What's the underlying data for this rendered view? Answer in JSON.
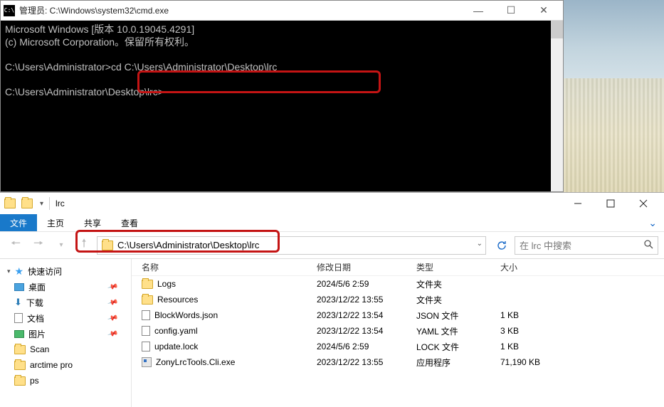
{
  "cmd": {
    "title": "管理员: C:\\Windows\\system32\\cmd.exe",
    "line1": "Microsoft Windows [版本 10.0.19045.4291]",
    "line2": "(c) Microsoft Corporation。保留所有权利。",
    "line3_prompt": "C:\\Users\\Administrator>",
    "line3_cmd": "cd C:\\Users\\Administrator\\Desktop\\lrc",
    "line4_prompt": "C:\\Users\\Administrator\\Desktop\\lrc>",
    "icon_text": "C:\\",
    "ctrl": {
      "min": "—",
      "max": "☐",
      "close": "✕"
    }
  },
  "explorer": {
    "title_folder": "lrc",
    "menu": {
      "file": "文件",
      "home": "主页",
      "share": "共享",
      "view": "查看"
    },
    "address": "C:\\Users\\Administrator\\Desktop\\lrc",
    "search_placeholder": "在 lrc 中搜索",
    "cols": {
      "name": "名称",
      "date": "修改日期",
      "type": "类型",
      "size": "大小"
    },
    "sidebar": {
      "quick": "快速访问",
      "items": [
        {
          "label": "桌面",
          "icon": "desk"
        },
        {
          "label": "下载",
          "icon": "dl"
        },
        {
          "label": "文档",
          "icon": "doc"
        },
        {
          "label": "图片",
          "icon": "pic"
        },
        {
          "label": "Scan",
          "icon": "folder"
        },
        {
          "label": "arctime pro",
          "icon": "folder"
        },
        {
          "label": "ps",
          "icon": "folder"
        }
      ]
    },
    "files": [
      {
        "name": "Logs",
        "date": "2024/5/6 2:59",
        "type": "文件夹",
        "size": "",
        "icon": "folder"
      },
      {
        "name": "Resources",
        "date": "2023/12/22 13:55",
        "type": "文件夹",
        "size": "",
        "icon": "folder"
      },
      {
        "name": "BlockWords.json",
        "date": "2023/12/22 13:54",
        "type": "JSON 文件",
        "size": "1 KB",
        "icon": "doc"
      },
      {
        "name": "config.yaml",
        "date": "2023/12/22 13:54",
        "type": "YAML 文件",
        "size": "3 KB",
        "icon": "doc"
      },
      {
        "name": "update.lock",
        "date": "2024/5/6 2:59",
        "type": "LOCK 文件",
        "size": "1 KB",
        "icon": "doc"
      },
      {
        "name": "ZonyLrcTools.Cli.exe",
        "date": "2023/12/22 13:55",
        "type": "应用程序",
        "size": "71,190 KB",
        "icon": "exe"
      }
    ]
  }
}
